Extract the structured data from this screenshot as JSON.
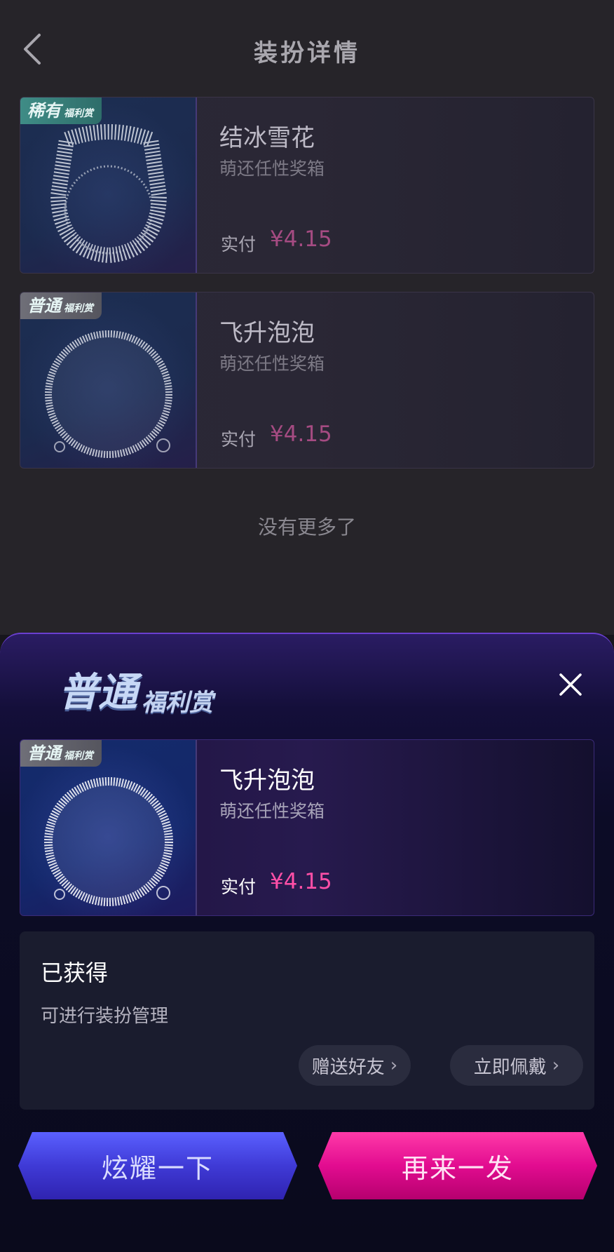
{
  "header": {
    "title": "装扮详情",
    "back_icon": "chevron-left-icon"
  },
  "list": [
    {
      "tag_big": "稀有",
      "tag_small": "福利赏",
      "tag_color": "#3f8c86",
      "name": "结冰雪花",
      "source": "萌还任性奖箱",
      "pay_label": "实付",
      "price": "¥4.15"
    },
    {
      "tag_big": "普通",
      "tag_small": "福利赏",
      "tag_color": "#6f6f78",
      "name": "飞升泡泡",
      "source": "萌还任性奖箱",
      "pay_label": "实付",
      "price": "¥4.15"
    }
  ],
  "no_more": "没有更多了",
  "sheet": {
    "badge_big": "普通",
    "badge_small": "福利赏",
    "close_icon": "close-icon",
    "item": {
      "tag_big": "普通",
      "tag_small": "福利赏",
      "name": "飞升泡泡",
      "source": "萌还任性奖箱",
      "pay_label": "实付",
      "price": "¥4.15"
    },
    "status_title": "已获得",
    "status_desc": "可进行装扮管理",
    "gift_label": "赠送好友",
    "wear_label": "立即佩戴",
    "chevron": "›",
    "show_button": "炫耀一下",
    "again_button": "再来一发",
    "accent_pink": "#ff4fa7",
    "accent_blue": "#4a4cf0"
  }
}
